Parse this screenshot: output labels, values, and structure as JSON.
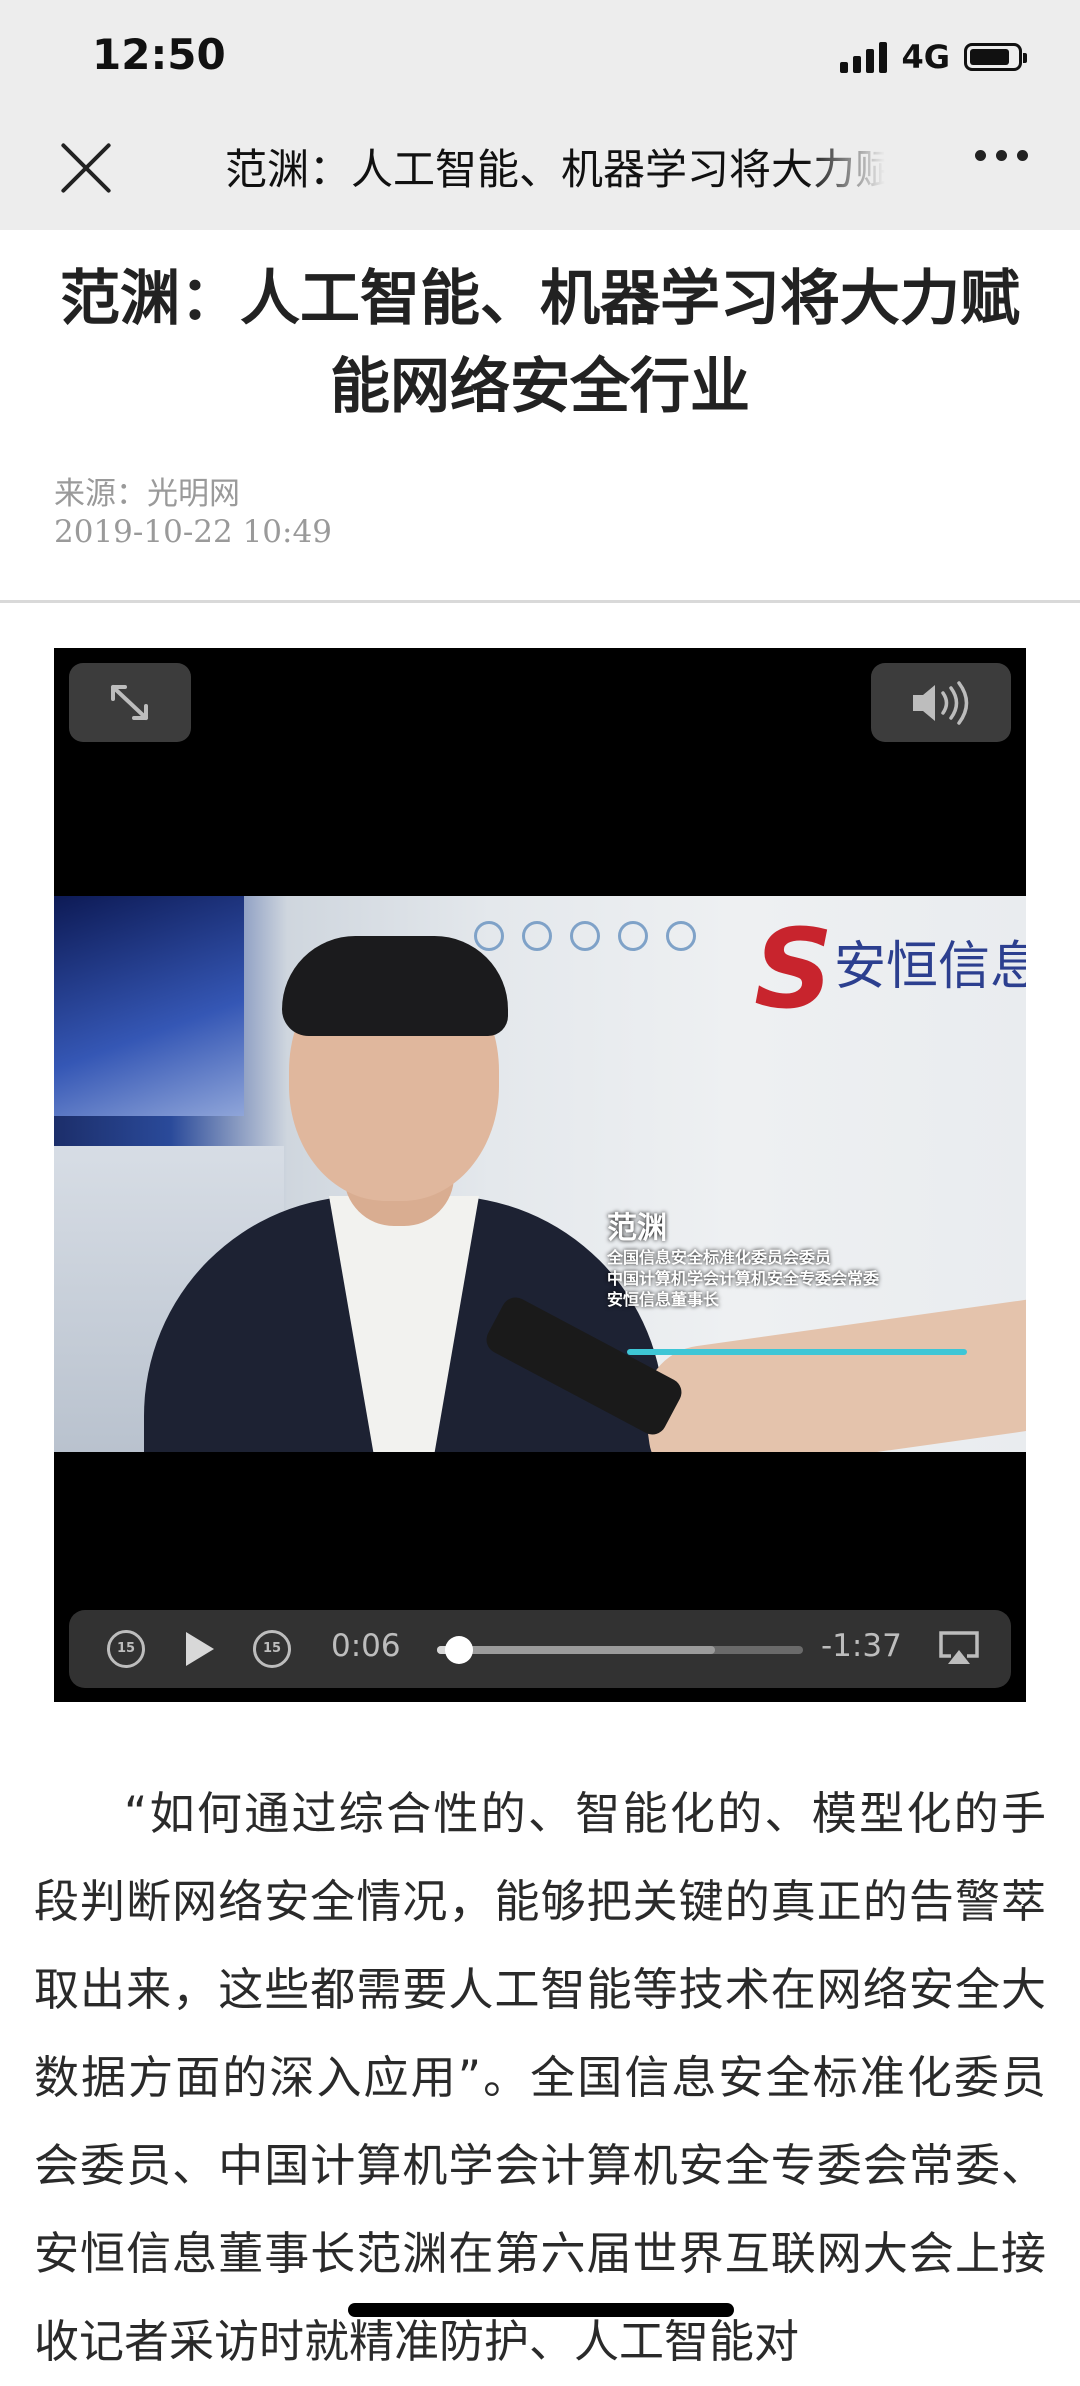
{
  "status_bar": {
    "time": "12:50",
    "network": "4G",
    "battery_level": 0.85,
    "signal_bars": 4
  },
  "nav": {
    "title": "范渊：人工智能、机器学习将大力赋能网络安全行业",
    "close_icon": "close-icon",
    "more_icon": "more-horizontal-icon"
  },
  "article": {
    "headline": "范渊：人工智能、机器学习将大力赋能网络安全行业",
    "source": "来源：光明网",
    "date": "2019-10-22 10:49",
    "body": "“如何通过综合性的、智能化的、模型化的手段判断网络安全情况，能够把关键的真正的告警萃取出来，这些都需要人工智能等技术在网络安全大数据方面的深入应用”。全国信息安全标准化委员会委员、中国计算机学会计算机安全专委会常委、安恒信息董事长范渊在第六届世界互联网大会上接收记者采访时就精准防护、人工智能对"
  },
  "video": {
    "expand_icon": "expand-icon",
    "volume_icon": "volume-icon",
    "caption": {
      "name": "范渊",
      "lines": [
        "全国信息安全标准化委员会委员",
        "中国计算机学会计算机安全专委会常委",
        "安恒信息董事长"
      ]
    },
    "backdrop_logo": "安恒信息",
    "controls": {
      "skip_back_label": "15",
      "skip_forward_label": "15",
      "play_icon": "play-icon",
      "current_time": "0:06",
      "remaining_time": "-1:37",
      "progress": 0.06,
      "buffered": 0.76,
      "airplay_icon": "airplay-icon"
    }
  },
  "colors": {
    "status_bg": "#ededed",
    "video_bg": "#000000",
    "meta_text": "#9a9a9a",
    "caption_bar": "#3ec6d6"
  }
}
